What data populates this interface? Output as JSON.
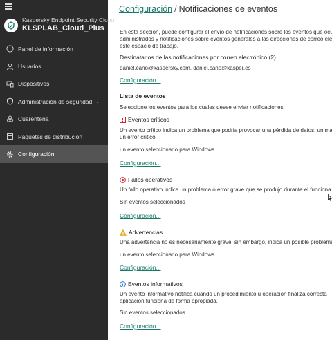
{
  "sidebar": {
    "product": "Kaspersky Endpoint Security Cloud",
    "tenant": "KLSPLAB_Cloud_Plus",
    "items": [
      {
        "label": "Panel de información",
        "icon": "info-icon"
      },
      {
        "label": "Usuarios",
        "icon": "user-icon"
      },
      {
        "label": "Dispositivos",
        "icon": "devices-icon"
      },
      {
        "label": "Administración de seguridad",
        "icon": "shield-icon"
      },
      {
        "label": "Cuarentena",
        "icon": "biohazard-icon"
      },
      {
        "label": "Paquetes de distribución",
        "icon": "package-icon"
      },
      {
        "label": "Configuración",
        "icon": "gear-icon"
      }
    ],
    "active_index": 6
  },
  "breadcrumb": {
    "parent": "Configuración",
    "separator": "/",
    "current": "Notificaciones de eventos"
  },
  "content": {
    "intro_1": "En esta sección, puede configurar el envío de notificaciones sobre los eventos que ocu",
    "intro_2": "administrados y notificaciones sobre eventos generales a las direcciones de correo ele",
    "intro_3": "este espacio de trabajo.",
    "recipients_title": "Destinatarios de las notificaciones por correo electrónico (2)",
    "recipients_value": "daniel.cano@kaspersky.com, daniel.cano@kasper.es",
    "configure_link": "Configuración...",
    "event_list_title": "Lista de eventos",
    "event_list_desc": "Seleccione los eventos para los cuales desee enviar notificaciones.",
    "sections": [
      {
        "title": "Eventos críticos",
        "icon": "critical-icon",
        "color": "#d7262b",
        "desc_1": "Un evento crítico indica un problema que podría provocar una pérdida de datos, un ma",
        "desc_2": "un error crítico.",
        "status": "un evento seleccionado para Windows.",
        "link": "Configuración..."
      },
      {
        "title": "Fallos operativos",
        "icon": "failure-icon",
        "color": "#d7262b",
        "desc_1": "Un fallo operativo indica un problema o error grave que se produjo durante el funciona",
        "desc_2": "",
        "status": "Sin eventos seleccionados",
        "link": "Configuración..."
      },
      {
        "title": "Advertencias",
        "icon": "warning-icon",
        "color": "#e0a020",
        "desc_1": "Una advertencia no es necesariamente grave; sin embargo, indica un posible problema",
        "desc_2": "",
        "status": "un evento seleccionado para Windows.",
        "link": "Configuración..."
      },
      {
        "title": "Eventos informativos",
        "icon": "info-event-icon",
        "color": "#2b7bd6",
        "desc_1": "Un evento informativo notifica cuando un procedimiento u operación finaliza correcta",
        "desc_2": "aplicación funciona de forma apropiada.",
        "status": "Sin eventos seleccionados",
        "link": "Configuración..."
      }
    ]
  },
  "colors": {
    "sidebar_bg": "#2b2b2b",
    "active_bg": "#545454",
    "accent_link": "#1a7a6a"
  }
}
